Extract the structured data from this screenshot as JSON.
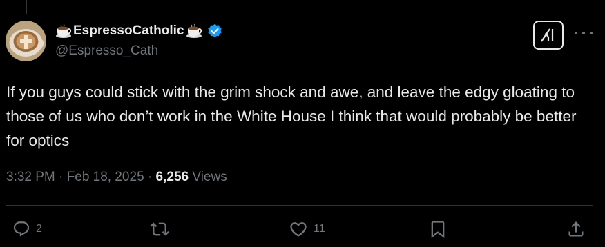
{
  "tweet": {
    "author": {
      "display_name": "EspressoCatholic",
      "handle": "@Espresso_Cath",
      "name_emoji": "coffee-cup",
      "verified": true
    },
    "text": "If you guys could stick with the grim shock and awe, and leave the edgy gloating to those of us who don’t work in the White House I think that would probably be better for optics",
    "time": "3:32 PM",
    "date": "Feb 18, 2025",
    "views_count": "6,256",
    "views_label": "Views",
    "separator": " · ",
    "actions": {
      "reply_count": "2",
      "retweet_count": "",
      "like_count": "11"
    }
  },
  "icons": {
    "reply": "reply-icon",
    "retweet": "retweet-icon",
    "like": "heart-icon",
    "bookmark": "bookmark-icon",
    "share": "share-icon",
    "grok": "grok-icon",
    "more": "more-icon",
    "verified": "verified-badge-icon"
  },
  "colors": {
    "background": "#000000",
    "text_primary": "#e7e9ea",
    "text_secondary": "#71767b",
    "verified_blue": "#1d9bf0",
    "divider": "#2f3336"
  }
}
